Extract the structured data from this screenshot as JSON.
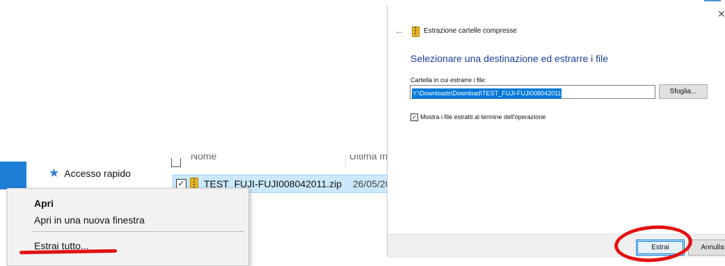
{
  "context_menu": {
    "open": "Apri",
    "open_new_window": "Apri in una nuova finestra",
    "extract_all": "Estrai tutto..."
  },
  "nav": {
    "quick_access": "Accesso rapido"
  },
  "file_list": {
    "header_name": "Nome",
    "header_date": "Ultima m",
    "row": {
      "name": "TEST_FUJI-FUJI008042011.zip",
      "date": "26/05/20"
    }
  },
  "dialog": {
    "title": "Estrazione cartelle compresse",
    "heading": "Selezionare una destinazione ed estrarre i file",
    "folder_label": "Cartella in cui estrarre i file:",
    "folder_value": "Y:\\Downloads\\Download\\TEST_FUJI-FUJI008042011",
    "browse": "Sfoglia...",
    "show_files_label": "Mostra i file estratti al termine dell'operazione",
    "extract": "Estrai",
    "cancel": "Annulla"
  },
  "icons": {
    "back": "back-arrow-icon",
    "close": "close-icon",
    "zip": "zip-folder-icon",
    "quick_access": "star-icon"
  },
  "colors": {
    "accent_blue": "#0078d7",
    "heading_blue": "#1a3d9c",
    "annotation_red": "#e3100f",
    "selection": "#cce8ff"
  }
}
